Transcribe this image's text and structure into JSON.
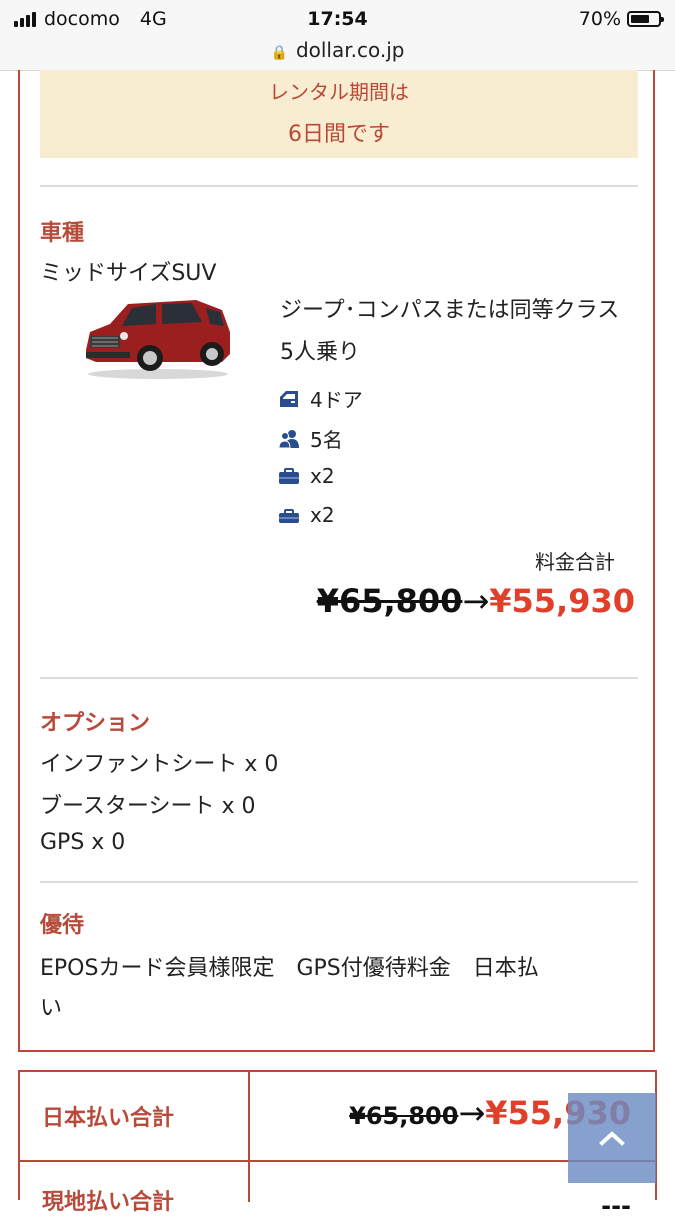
{
  "statusbar": {
    "carrier": "docomo",
    "network": "4G",
    "time": "17:54",
    "battery": "70%",
    "battery_level": 0.7,
    "url": "dollar.co.jp"
  },
  "rental": {
    "line1": "レンタル期間は",
    "line2": "6日間です"
  },
  "vehicle": {
    "title": "車種",
    "class": "ミッドサイズSUV",
    "name": "ジープ･コンパスまたは同等クラス5人乗り",
    "specs": [
      {
        "icon": "door-icon",
        "text": "4ドア"
      },
      {
        "icon": "people-icon",
        "text": "5名"
      },
      {
        "icon": "large-luggage-icon",
        "text": "x2"
      },
      {
        "icon": "small-luggage-icon",
        "text": "x2"
      }
    ],
    "price_label": "料金合計",
    "price_old": "¥65,800",
    "arrow": "→",
    "price_new": "¥55,930"
  },
  "options": {
    "title": "オプション",
    "items": [
      "インファントシート x 0",
      "ブースターシート x 0",
      "GPS x 0"
    ]
  },
  "benefit": {
    "title": "優待",
    "line1": "EPOSカード会員様限定　GPS付優待料金　日本払",
    "line2": "い"
  },
  "totals": {
    "japan_label": "日本払い合計",
    "japan_old": "¥65,800",
    "arrow": "→",
    "japan_new": "¥55,930",
    "local_label": "現地払い合計",
    "local_value": "---"
  },
  "colors": {
    "accent": "#b84a3a",
    "price_red": "#e0402a",
    "banner_bg": "#f8ecd1",
    "scroll_button": "#6c8cc4",
    "icon_blue": "#2a4d8f"
  }
}
